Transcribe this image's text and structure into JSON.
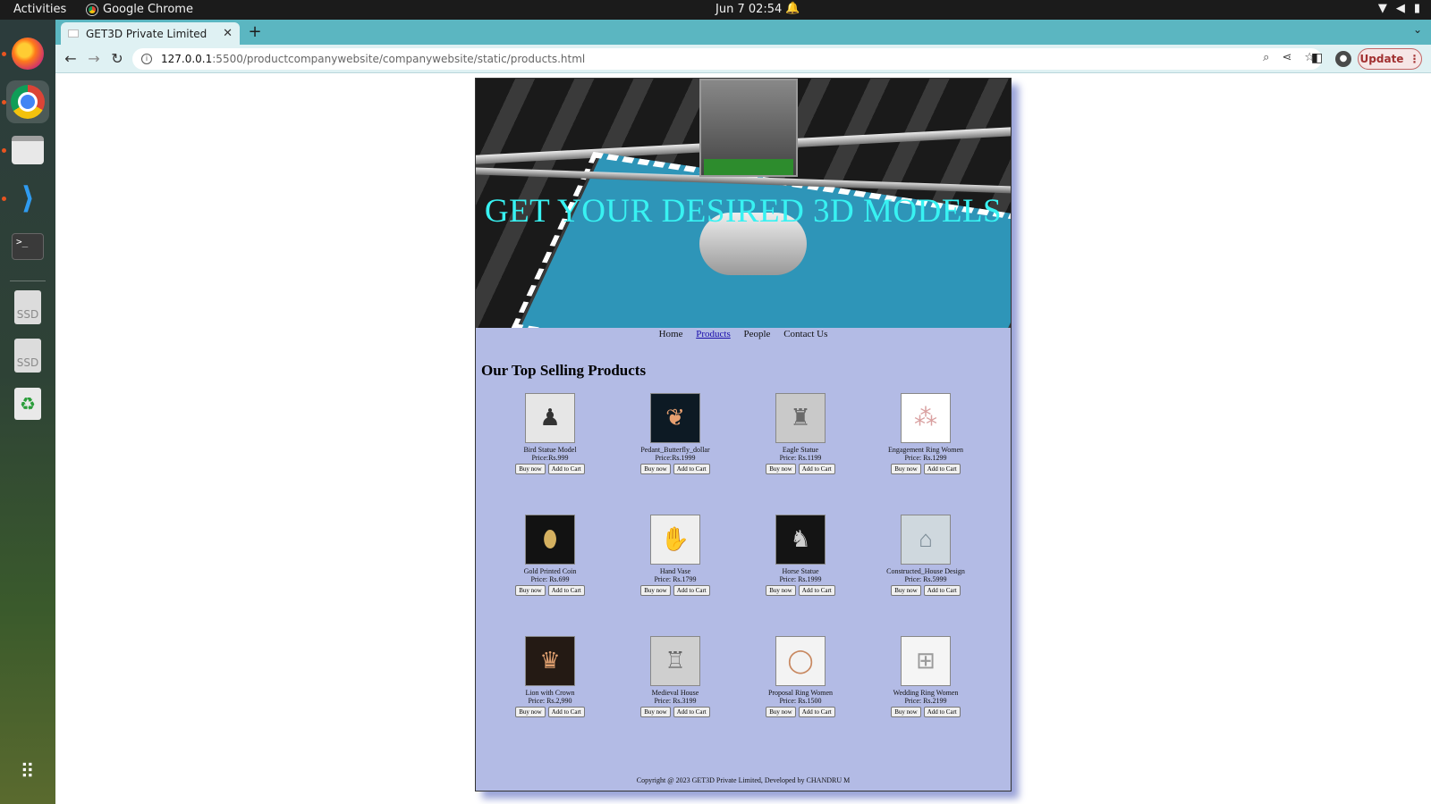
{
  "system": {
    "activities": "Activities",
    "app_name": "Google Chrome",
    "clock": "Jun 7  02:54"
  },
  "browser": {
    "tab_title": "GET3D Private Limited",
    "url_host": "127.0.0.1",
    "url_path": ":5500/productcompanywebsite/companywebsite/static/products.html",
    "update_label": "Update"
  },
  "page": {
    "hero_title": "GET YOUR DESIRED 3D MODELS",
    "nav": [
      "Home",
      "Products",
      "People",
      "Contact Us"
    ],
    "section_title": "Our Top Selling Products",
    "buy_label": "Buy now",
    "cart_label": "Add to Cart",
    "products": [
      {
        "name": "Bird Statue Model",
        "price": "Price:Rs.999",
        "icon": "bird-statue-icon",
        "bg": "#e6e6e6",
        "fg": "#333333",
        "glyph": "♟"
      },
      {
        "name": "Pedant_Butterfly_dollar",
        "price": "Price:Rs.1999",
        "icon": "butterfly-pendant-icon",
        "bg": "#0d1a24",
        "fg": "#e8a070",
        "glyph": "❦"
      },
      {
        "name": "Eagle Statue",
        "price": "Price: Rs.1199",
        "icon": "eagle-statue-icon",
        "bg": "#c9c9c9",
        "fg": "#6a6a6a",
        "glyph": "♜"
      },
      {
        "name": "Engagement Ring Women",
        "price": "Price: Rs.1299",
        "icon": "ring-pattern-icon",
        "bg": "#ffffff",
        "fg": "#d9a0a0",
        "glyph": "⁂"
      },
      {
        "name": "Gold Printed Coin",
        "price": "Price: Rs.699",
        "icon": "gold-coin-icon",
        "bg": "#121212",
        "fg": "#d4b060",
        "glyph": "⬮"
      },
      {
        "name": "Hand Vase",
        "price": "Price: Rs.1799",
        "icon": "hand-vase-icon",
        "bg": "#efefef",
        "fg": "#bdbdbd",
        "glyph": "✋"
      },
      {
        "name": "Horse Statue",
        "price": "Price: Rs.1999",
        "icon": "horse-statue-icon",
        "bg": "#141414",
        "fg": "#cfcfcf",
        "glyph": "♞"
      },
      {
        "name": "Constructed_House Design",
        "price": "Price: Rs.5999",
        "icon": "house-icon",
        "bg": "#cfd8de",
        "fg": "#7a8a95",
        "glyph": "⌂"
      },
      {
        "name": "Lion with Crown",
        "price": "Price: Rs.2,990",
        "icon": "lion-statue-icon",
        "bg": "#241a14",
        "fg": "#e0a070",
        "glyph": "♛"
      },
      {
        "name": "Medieval House",
        "price": "Price: Rs.3199",
        "icon": "medieval-house-icon",
        "bg": "#cfcfcf",
        "fg": "#666666",
        "glyph": "♖"
      },
      {
        "name": "Proposal Ring Women",
        "price": "Price: Rs.1500",
        "icon": "proposal-ring-icon",
        "bg": "#f3f3f3",
        "fg": "#c88860",
        "glyph": "◯"
      },
      {
        "name": "Wedding Ring Women",
        "price": "Price: Rs.2199",
        "icon": "wedding-ring-icon",
        "bg": "#f5f5f5",
        "fg": "#9a9a9a",
        "glyph": "⊞"
      }
    ],
    "footer": "Copyright @ 2023 GET3D Private Limited, Developed by CHANDRU M"
  }
}
